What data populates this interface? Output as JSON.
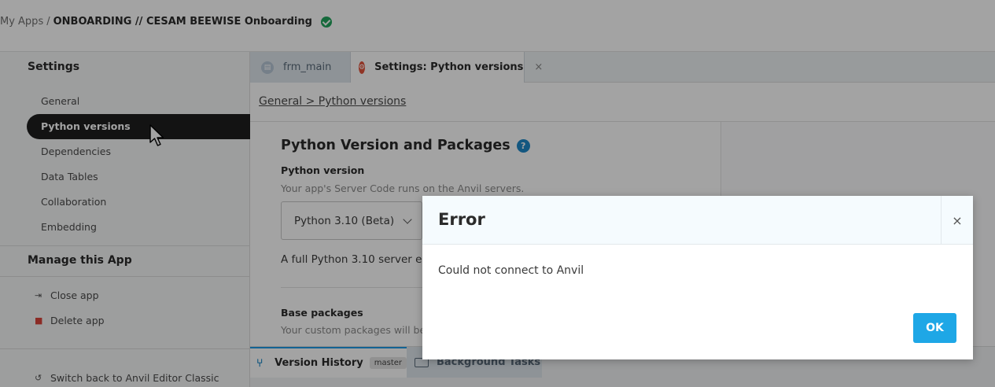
{
  "topbar": {
    "crumb_root": "My Apps",
    "crumb_sep": "/",
    "app_name": "ONBOARDING // CESAM BEEWISE Onboarding"
  },
  "sidebar": {
    "heading": "Settings",
    "items": [
      {
        "label": "General"
      },
      {
        "label": "Python versions",
        "active": true
      },
      {
        "label": "Dependencies"
      },
      {
        "label": "Data Tables"
      },
      {
        "label": "Collaboration"
      },
      {
        "label": "Embedding"
      }
    ],
    "manage_heading": "Manage this App",
    "actions": [
      {
        "label": "Close app",
        "icon": "exit-icon"
      },
      {
        "label": "Delete app",
        "icon": "trash-icon"
      }
    ],
    "switch_back": "Switch back to Anvil Editor Classic"
  },
  "tabs": [
    {
      "label": "frm_main",
      "icon": "form-icon"
    },
    {
      "label": "Settings: Python versions",
      "icon": "settings-icon",
      "active": true
    }
  ],
  "main": {
    "breadcrumb": "General > Python versions",
    "title": "Python Version and Packages",
    "python_version_label": "Python version",
    "python_version_hint": "Your app's Server Code runs on the Anvil servers.",
    "selected_version": "Python 3.10 (Beta)",
    "description_partial": "A full Python 3.10 server en",
    "base_packages_label": "Base packages",
    "base_packages_hint": "Your custom packages will be"
  },
  "dock": {
    "version_history": "Version History",
    "branch": "master",
    "background_tasks": "Background Tasks"
  },
  "modal": {
    "title": "Error",
    "message": "Could not connect to Anvil",
    "ok_label": "OK",
    "close_glyph": "×"
  },
  "colors": {
    "accent": "#1ea7e6",
    "success": "#22a45d",
    "danger": "#d9443a"
  }
}
